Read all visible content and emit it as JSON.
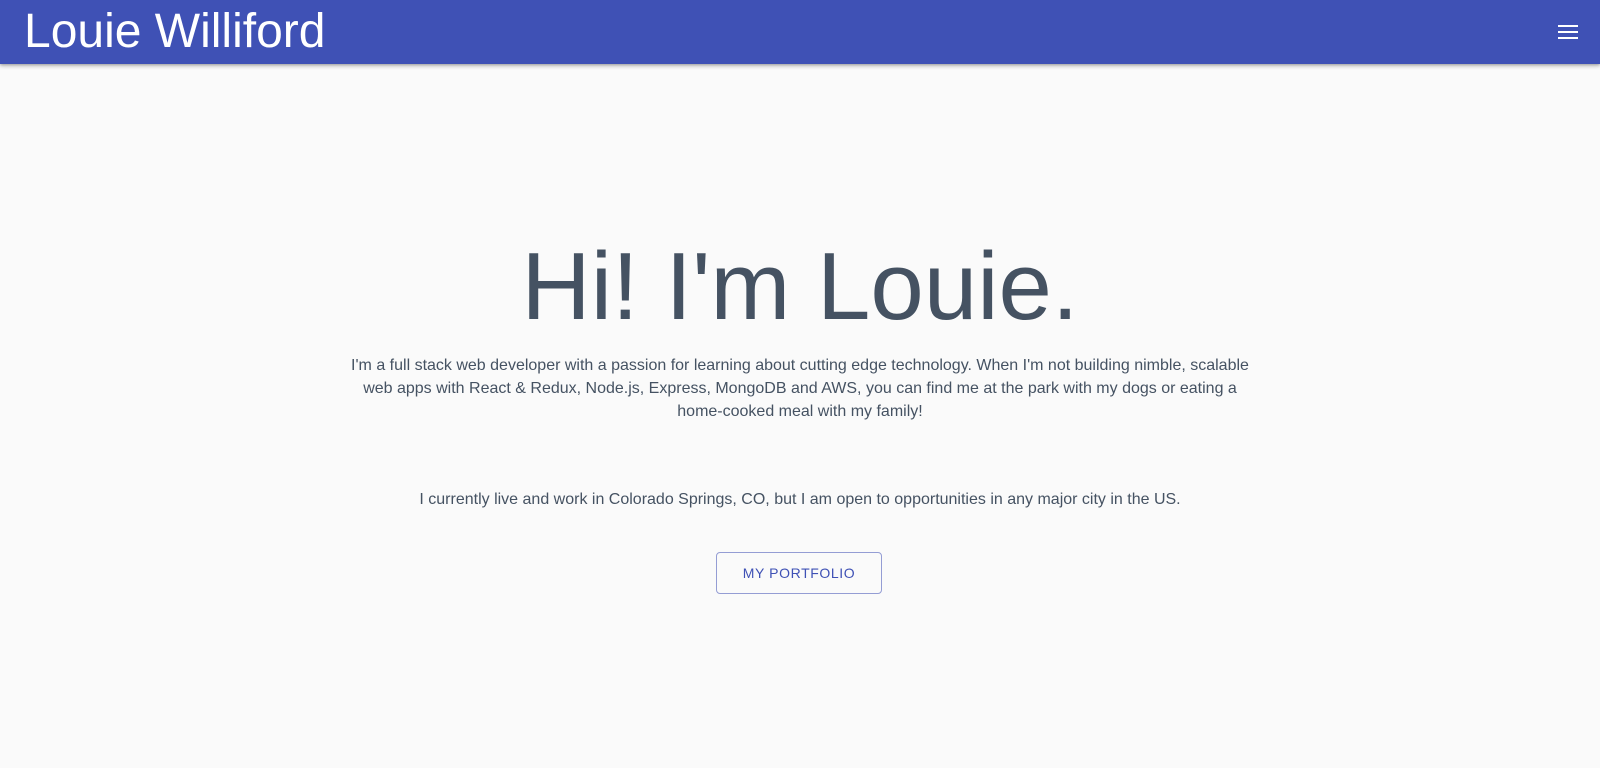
{
  "header": {
    "title": "Louie Williford",
    "menu_icon": "hamburger-menu-icon",
    "background_color": "#3f51b5"
  },
  "hero": {
    "heading": "Hi! I'm Louie.",
    "intro": "I'm a full stack web developer with a passion for learning about cutting edge technology. When I'm not building nimble, scalable web apps with React & Redux, Node.js, Express, MongoDB and AWS, you can find me at the park with my dogs or eating a home-cooked meal with my family!",
    "location": "I currently live and work in Colorado Springs, CO, but I am open to opportunities in any major city in the US.",
    "portfolio_button_label": "MY PORTFOLIO",
    "text_color": "#455262",
    "accent_color": "#3f51b5"
  }
}
